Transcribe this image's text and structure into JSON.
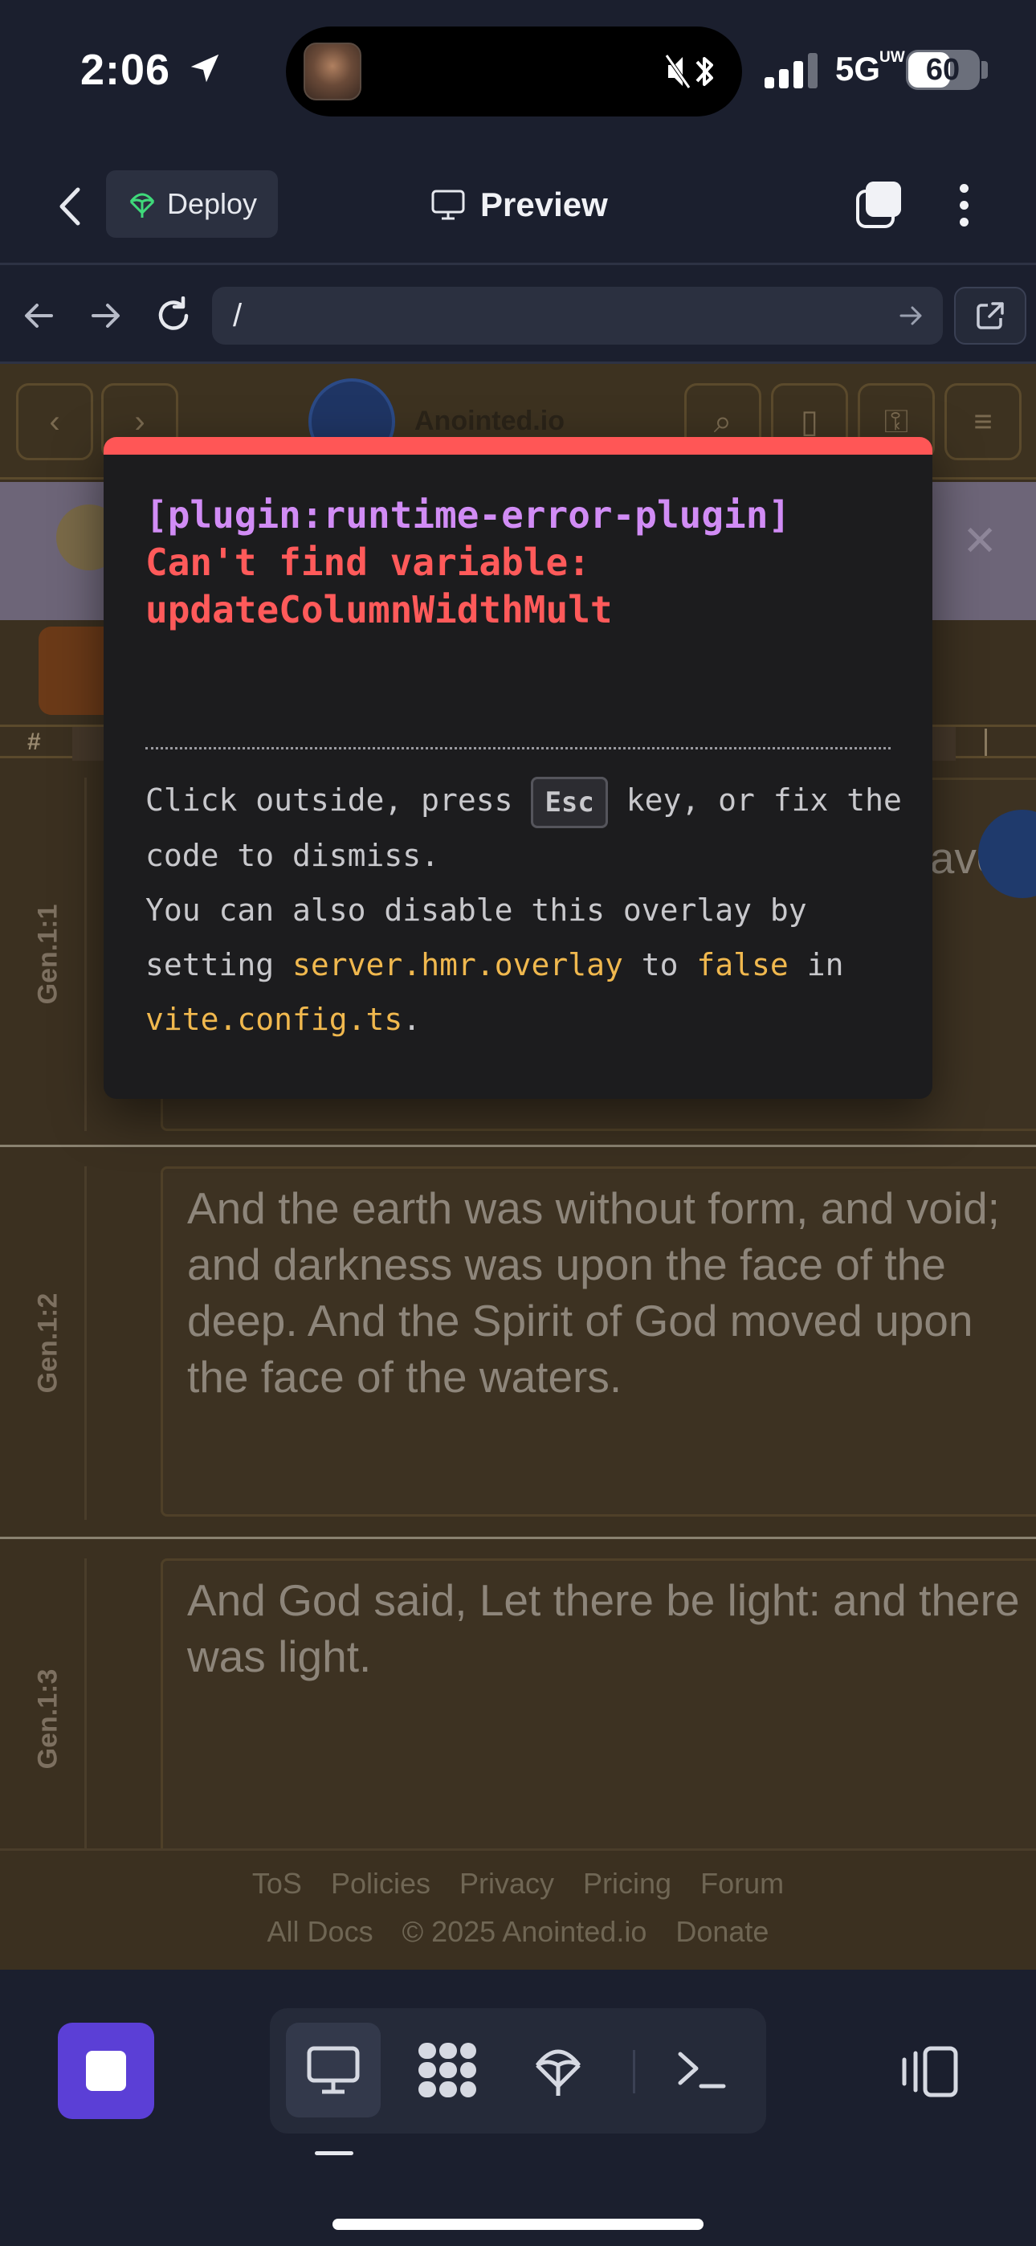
{
  "status_bar": {
    "time": "2:06",
    "network": "5G",
    "network_sub": "UW",
    "battery": "60"
  },
  "top_bar": {
    "deploy_label": "Deploy",
    "preview_label": "Preview"
  },
  "url_bar": {
    "url": "/"
  },
  "app": {
    "name": "Anointed.io",
    "table_header_hash": "#",
    "verses": [
      {
        "ref": "Gen.1:1",
        "text": "aven"
      },
      {
        "ref": "Gen.1:2",
        "text": "And the earth was without form, and void; and darkness was upon the face of the deep. And the Spirit of God moved upon the face of the waters."
      },
      {
        "ref": "Gen.1:3",
        "text": "And God said, Let there be light: and there was light."
      }
    ],
    "footer": {
      "row1": [
        "ToS",
        "Policies",
        "Privacy",
        "Pricing",
        "Forum"
      ],
      "row2": [
        "All Docs",
        "© 2025 Anointed.io",
        "Donate"
      ]
    }
  },
  "error_overlay": {
    "plugin": "[plugin:runtime-error-plugin]",
    "message_line1": "Can't find variable:",
    "message_line2": "updateColumnWidthMult",
    "tip_part1": "Click outside, press",
    "tip_key": "Esc",
    "tip_part2": "key, or fix the code to dismiss.",
    "tip_part3": "You can also disable this overlay by setting",
    "tip_code1": "server.hmr.overlay",
    "tip_part4": "to",
    "tip_code2": "false",
    "tip_part5": "in",
    "tip_code3": "vite.config.ts",
    "tip_part6": "."
  },
  "colors": {
    "accent": "#5b3fd6",
    "error": "#ff5656",
    "plugin": "#d18cf5",
    "code": "#f0b84e"
  }
}
